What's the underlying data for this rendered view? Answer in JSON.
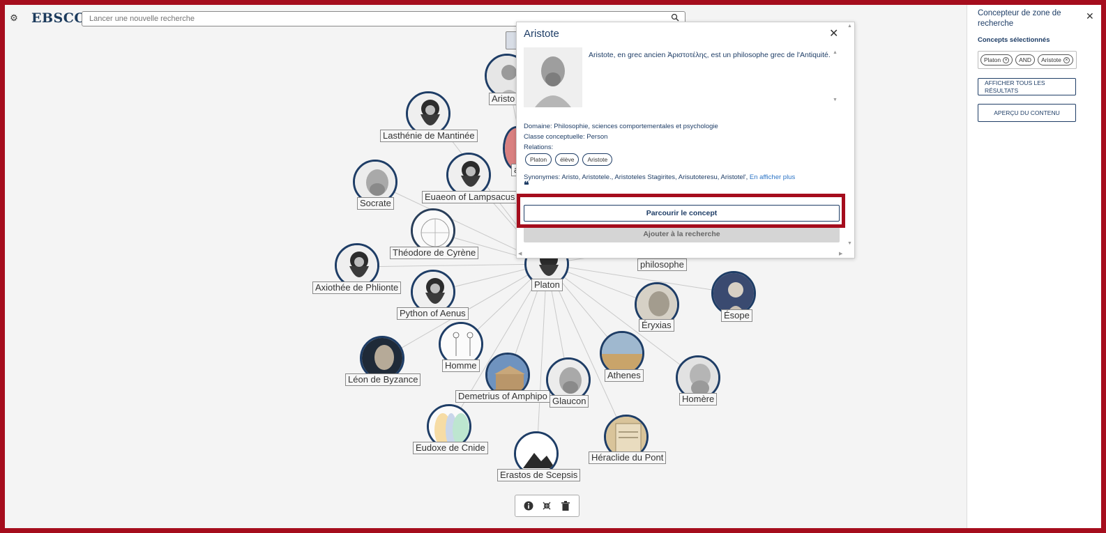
{
  "header": {
    "logo": "EBSCO",
    "search_placeholder": "Lancer une nouvelle recherche"
  },
  "colors": {
    "navy": "#1e3d66",
    "frame_red": "#a50d1d",
    "link": "#2a73c5"
  },
  "graph": {
    "nodes": [
      {
        "id": "platon",
        "label": "Platon",
        "img": "bust"
      },
      {
        "id": "aristote",
        "label": "Aristo",
        "img": "bust"
      },
      {
        "id": "lasthenie",
        "label": "Lasthénie de Mantinée",
        "img": "beard"
      },
      {
        "id": "socrate",
        "label": "Socrate",
        "img": "bust"
      },
      {
        "id": "euaeon",
        "label": "Euaeon of Lampsacus",
        "img": "beard"
      },
      {
        "id": "theodore",
        "label": "Théodore de Cyrène",
        "img": "sketch"
      },
      {
        "id": "axiothee",
        "label": "Axiothée de Phlionte",
        "img": "beard"
      },
      {
        "id": "python",
        "label": "Python of Aenus",
        "img": "beard"
      },
      {
        "id": "leon",
        "label": "Léon de Byzance",
        "img": "statue"
      },
      {
        "id": "homme",
        "label": "Homme",
        "img": "sketch"
      },
      {
        "id": "demetrius",
        "label": "Demetrius of Amphipo",
        "img": "temple"
      },
      {
        "id": "glaucon",
        "label": "Glaucon",
        "img": "bust"
      },
      {
        "id": "eudoxe",
        "label": "Eudoxe de Cnide",
        "img": "lens"
      },
      {
        "id": "erastos",
        "label": "Erastos de Scepsis",
        "img": "placeholder"
      },
      {
        "id": "heraclide",
        "label": "Héraclide du Pont",
        "img": "book"
      },
      {
        "id": "athenes",
        "label": "Athenes",
        "img": "city"
      },
      {
        "id": "eryxias",
        "label": "Éryxias",
        "img": "bust"
      },
      {
        "id": "esope",
        "label": "Ésope",
        "img": "statue"
      },
      {
        "id": "homere",
        "label": "Homère",
        "img": "bust"
      },
      {
        "id": "philosophe",
        "label": "philosophe",
        "img": "dark"
      },
      {
        "id": "red",
        "label": "a",
        "img": "red"
      }
    ]
  },
  "bottom_toolbar": {
    "info_icon": "info-icon",
    "collapse_icon": "collapse-icon",
    "trash_icon": "trash-icon"
  },
  "sidebar": {
    "title": "Concepteur de zone de recherche",
    "subtitle": "Concepts sélectionnés",
    "chips": [
      "Platon",
      "AND",
      "Aristote"
    ],
    "btn_all": "AFFICHER TOUS LES RÉSULTATS",
    "btn_preview": "APERÇU DU CONTENU"
  },
  "popup": {
    "title": "Aristote",
    "description": "Aristote, en grec ancien Ἀριστοτέλης, est un philosophe grec de l'Antiquité.",
    "domain": "Domaine: Philosophie, sciences comportementales et psychologie",
    "class": "Classe conceptuelle: Person",
    "relations_label": "Relations:",
    "relations": [
      "Platon",
      "élève",
      "Aristote"
    ],
    "synonyms": "Synonymes: Aristo, Aristotele., Aristoteles Stagirites, Arisutoteresu, Aristotel',",
    "more_link": "En afficher plus",
    "quote": "❝",
    "btn_browse": "Parcourir le concept",
    "btn_add": "Ajouter à la recherche"
  }
}
